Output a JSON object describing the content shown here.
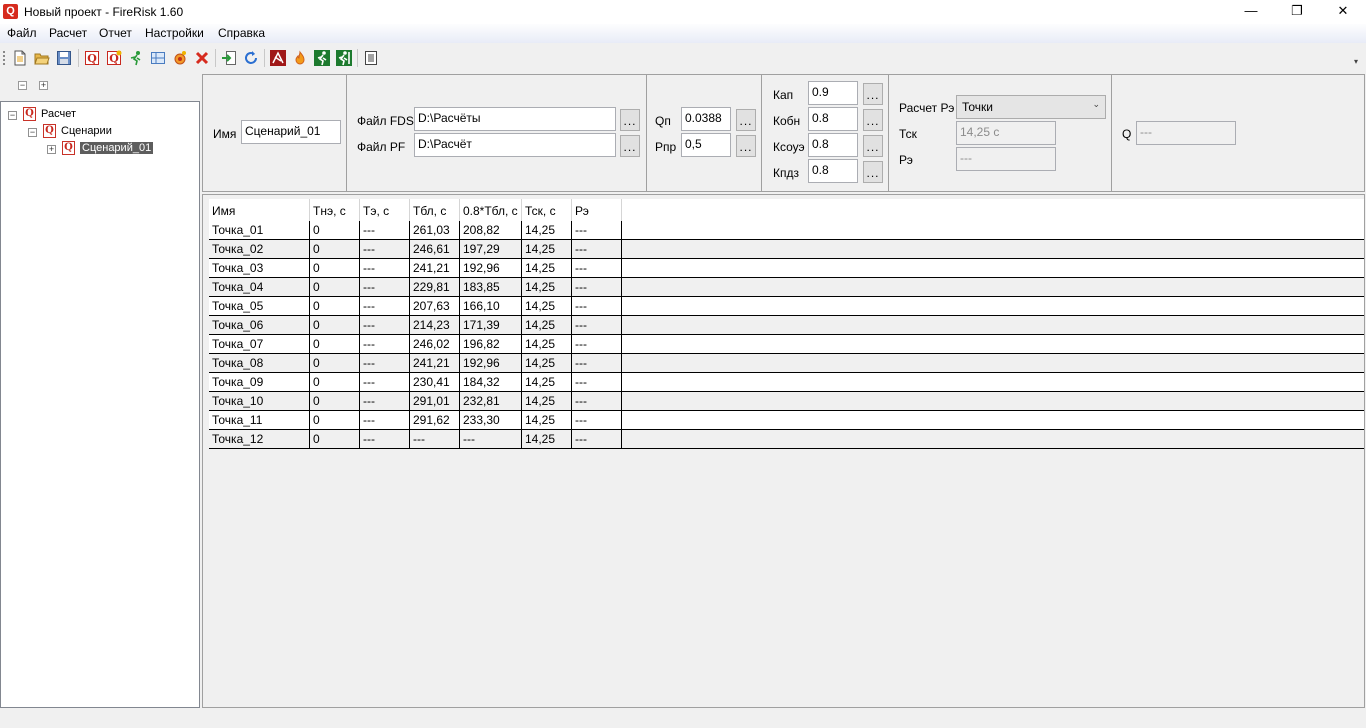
{
  "window": {
    "title": "Новый проект - FireRisk 1.60",
    "app_icon": "Q",
    "minimize": "—",
    "restore": "❐",
    "close": "✕"
  },
  "menu": [
    "Файл",
    "Расчет",
    "Отчет",
    "Настройки",
    "Справка"
  ],
  "toolbar": {
    "icons": [
      "new-file-icon",
      "open-folder-icon",
      "save-icon",
      "add-calc-icon",
      "add-scenario-icon",
      "runner-icon",
      "plan-icon",
      "fire-point-icon",
      "delete-icon",
      "import-icon",
      "refresh-icon",
      "hazard-icon",
      "flame-icon",
      "evacuation-icon",
      "evacuation-exit-icon",
      "report-icon"
    ]
  },
  "tree": {
    "collapse_all": "−",
    "expand_all": "+",
    "nodes": [
      {
        "label": "Расчет"
      },
      {
        "label": "Сценарии"
      },
      {
        "label": "Сценарий_01"
      }
    ]
  },
  "params": {
    "name_label": "Имя",
    "name_value": "Сценарий_01",
    "fds_label": "Файл FDS",
    "fds_value": "D:\\Расчёты",
    "pf_label": "Файл PF",
    "pf_value": "D:\\Расчёт",
    "dots": "...",
    "qp_label": "Qп",
    "qp_value": "0.0388",
    "ppr_label": "Рпр",
    "ppr_value": "0,5",
    "kap_label": "Кап",
    "kap_value": "0.9",
    "kobn_label": "Кобн",
    "kobn_value": "0.8",
    "ksoue_label": "Ксоуэ",
    "ksoue_value": "0.8",
    "kpdz_label": "Кпдз",
    "kpdz_value": "0.8",
    "pe_calc_label": "Расчет Рэ",
    "pe_calc_value": "Точки",
    "tsk_label": "Тск",
    "tsk_value": "14,25 с",
    "pe_label": "Рэ",
    "pe_value": "---",
    "q_label": "Q",
    "q_value": "---"
  },
  "table": {
    "columns": [
      "Имя",
      "Тнэ, с",
      "Тэ, с",
      "Тбл, с",
      "0.8*Тбл, с",
      "Тск, с",
      "Рэ"
    ],
    "rows": [
      [
        "Точка_01",
        "0",
        "---",
        "261,03",
        "208,82",
        "14,25",
        "---"
      ],
      [
        "Точка_02",
        "0",
        "---",
        "246,61",
        "197,29",
        "14,25",
        "---"
      ],
      [
        "Точка_03",
        "0",
        "---",
        "241,21",
        "192,96",
        "14,25",
        "---"
      ],
      [
        "Точка_04",
        "0",
        "---",
        "229,81",
        "183,85",
        "14,25",
        "---"
      ],
      [
        "Точка_05",
        "0",
        "---",
        "207,63",
        "166,10",
        "14,25",
        "---"
      ],
      [
        "Точка_06",
        "0",
        "---",
        "214,23",
        "171,39",
        "14,25",
        "---"
      ],
      [
        "Точка_07",
        "0",
        "---",
        "246,02",
        "196,82",
        "14,25",
        "---"
      ],
      [
        "Точка_08",
        "0",
        "---",
        "241,21",
        "192,96",
        "14,25",
        "---"
      ],
      [
        "Точка_09",
        "0",
        "---",
        "230,41",
        "184,32",
        "14,25",
        "---"
      ],
      [
        "Точка_10",
        "0",
        "---",
        "291,01",
        "232,81",
        "14,25",
        "---"
      ],
      [
        "Точка_11",
        "0",
        "---",
        "291,62",
        "233,30",
        "14,25",
        "---"
      ],
      [
        "Точка_12",
        "0",
        "---",
        "---",
        "---",
        "14,25",
        "---"
      ]
    ]
  }
}
